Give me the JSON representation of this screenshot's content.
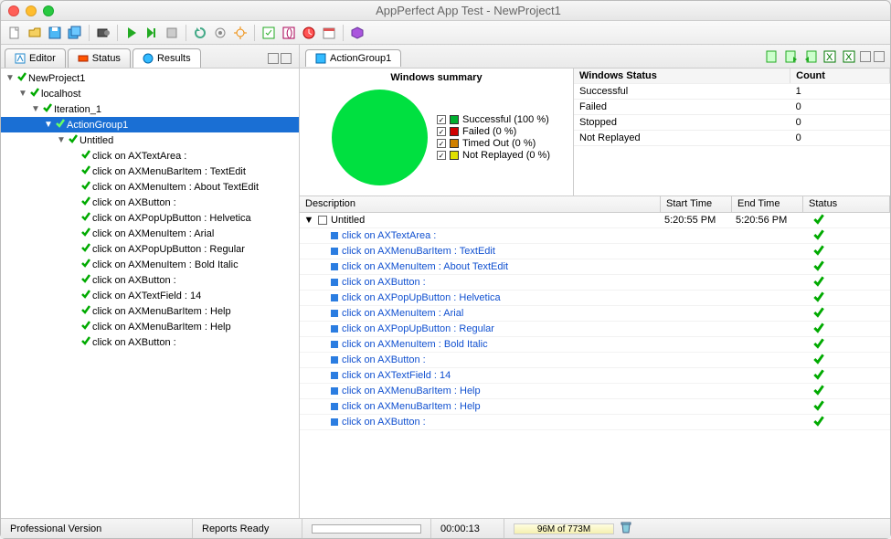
{
  "window": {
    "title": "AppPerfect App Test - NewProject1"
  },
  "tabs": {
    "editor": "Editor",
    "status": "Status",
    "results": "Results"
  },
  "tree": {
    "root": "NewProject1",
    "host": "localhost",
    "iteration": "Iteration_1",
    "group": "ActionGroup1",
    "untitled": "Untitled",
    "actions": [
      "click on AXTextArea :",
      "click on AXMenuBarItem : TextEdit",
      "click on AXMenuItem : About TextEdit",
      "click on AXButton :",
      "click on AXPopUpButton : Helvetica",
      "click on AXMenuItem : Arial",
      "click on AXPopUpButton : Regular",
      "click on AXMenuItem : Bold Italic",
      "click on AXButton :",
      "click on AXTextField : 14",
      "click on AXMenuBarItem : Help",
      "click on AXMenuBarItem : Help",
      "click on AXButton :"
    ]
  },
  "right_tab": "ActionGroup1",
  "chart_data": {
    "type": "pie",
    "title": "Windows summary",
    "categories": [
      "Successful",
      "Failed",
      "Timed Out",
      "Not Replayed"
    ],
    "values": [
      100,
      0,
      0,
      0
    ],
    "series": [
      {
        "name": "Successful (100 %)",
        "color": "#00b030"
      },
      {
        "name": "Failed (0 %)",
        "color": "#d00000"
      },
      {
        "name": "Timed Out (0 %)",
        "color": "#d08000"
      },
      {
        "name": "Not Replayed (0 %)",
        "color": "#e0e000"
      }
    ]
  },
  "stats": {
    "hdr_status": "Windows Status",
    "hdr_count": "Count",
    "rows": [
      {
        "label": "Successful",
        "count": "1"
      },
      {
        "label": "Failed",
        "count": "0"
      },
      {
        "label": "Stopped",
        "count": "0"
      },
      {
        "label": "Not Replayed",
        "count": "0"
      }
    ]
  },
  "detail_hdr": {
    "desc": "Description",
    "start": "Start Time",
    "end": "End Time",
    "status": "Status"
  },
  "detail_parent": {
    "label": "Untitled",
    "start": "5:20:55 PM",
    "end": "5:20:56 PM"
  },
  "statusbar": {
    "edition": "Professional Version",
    "reports": "Reports Ready",
    "time": "00:00:13",
    "mem": "96M of 773M"
  }
}
